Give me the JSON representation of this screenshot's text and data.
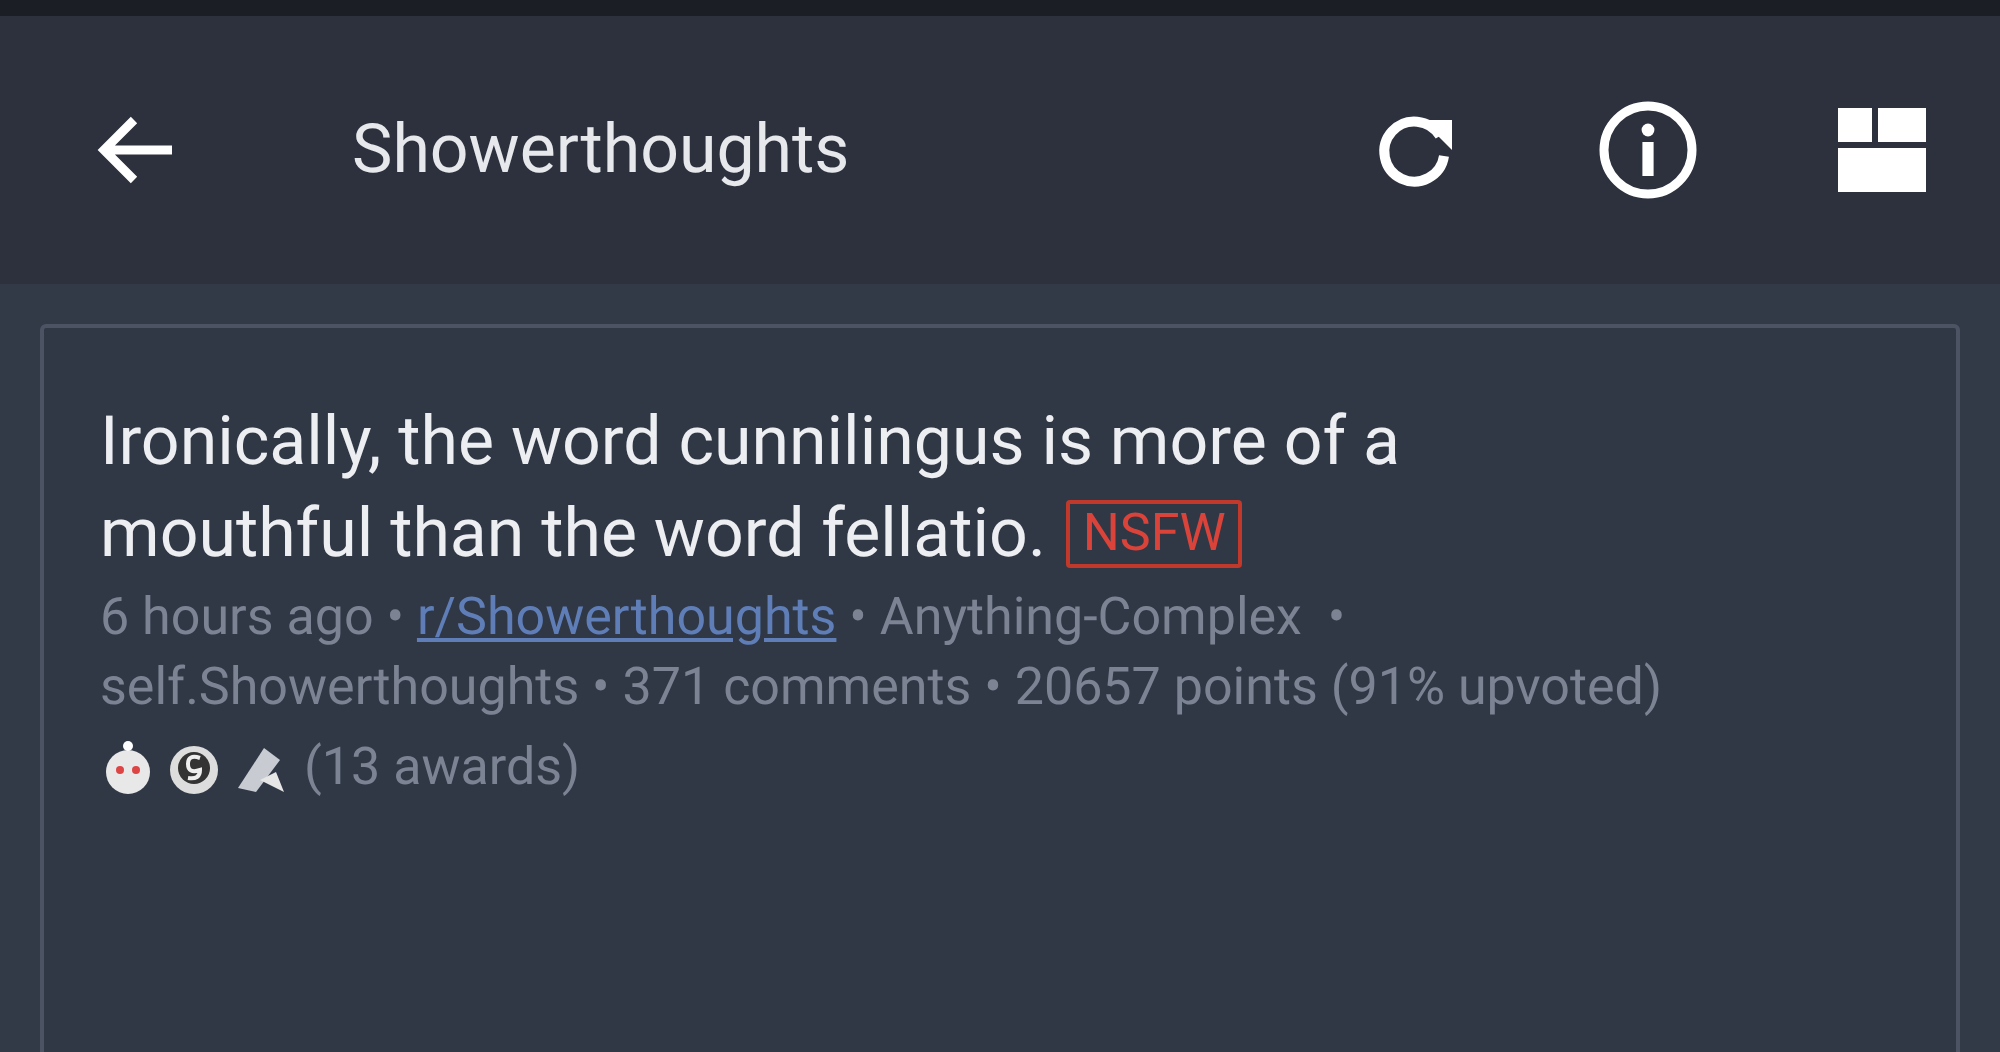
{
  "toolbar": {
    "title": "Showerthoughts"
  },
  "post": {
    "title": "Ironically, the word cunnilingus is more of a mouthful than the word fellatio.",
    "nsfw_tag": "NSFW",
    "meta_lines": [
      [
        {
          "kind": "text",
          "text": "6 hours ago • "
        },
        {
          "kind": "link",
          "text": "r/Showerthoughts"
        },
        {
          "kind": "text",
          "text": " • Anything-Complex  •"
        }
      ],
      [
        {
          "kind": "text",
          "text": "self.Showerthoughts • 371 comments • 20657 points (91% upvoted)"
        }
      ]
    ],
    "awards": {
      "count_text": "(13 awards)"
    }
  }
}
